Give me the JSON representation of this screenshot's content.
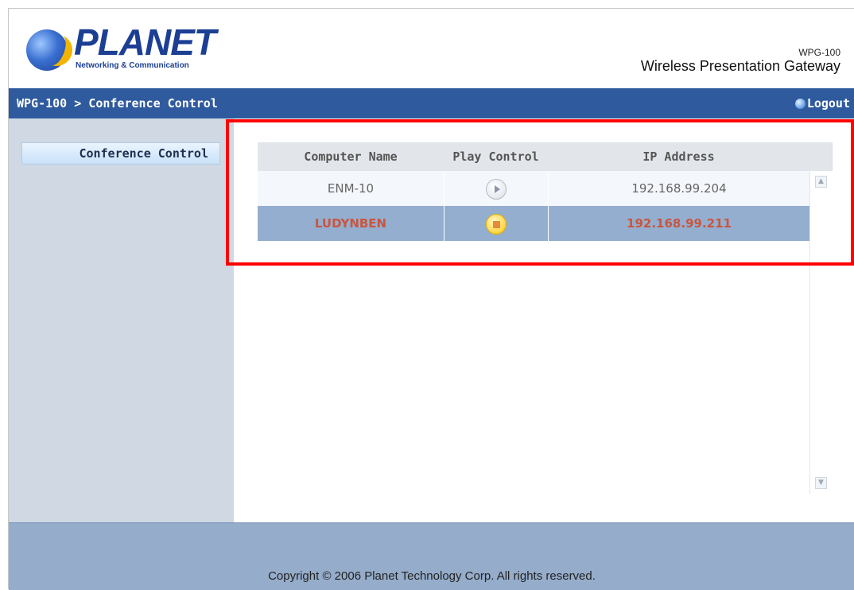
{
  "header": {
    "logo_text": "PLANET",
    "logo_subtitle": "Networking & Communication",
    "product_model": "WPG-100",
    "product_name": "Wireless Presentation Gateway"
  },
  "navbar": {
    "breadcrumb": "WPG-100 > Conference Control",
    "logout_label": "Logout"
  },
  "sidebar": {
    "items": [
      {
        "label": "Conference Control"
      }
    ]
  },
  "table": {
    "columns": [
      "Computer Name",
      "Play Control",
      "IP Address"
    ],
    "rows": [
      {
        "computer_name": "ENM-10",
        "play_control": "play-icon",
        "ip_address": "192.168.99.204"
      },
      {
        "computer_name": "LUDYNBEN",
        "play_control": "stop-icon",
        "ip_address": "192.168.99.211"
      }
    ]
  },
  "footer": {
    "copyright": "Copyright © 2006 Planet Technology Corp. All rights reserved."
  },
  "colors": {
    "navbar": "#2f5a9e",
    "sidebar": "#cfd8e3",
    "selected_row": "#94aecf",
    "selected_text": "#c9563f",
    "highlight_box": "#ff0000",
    "footer": "#95acca"
  }
}
